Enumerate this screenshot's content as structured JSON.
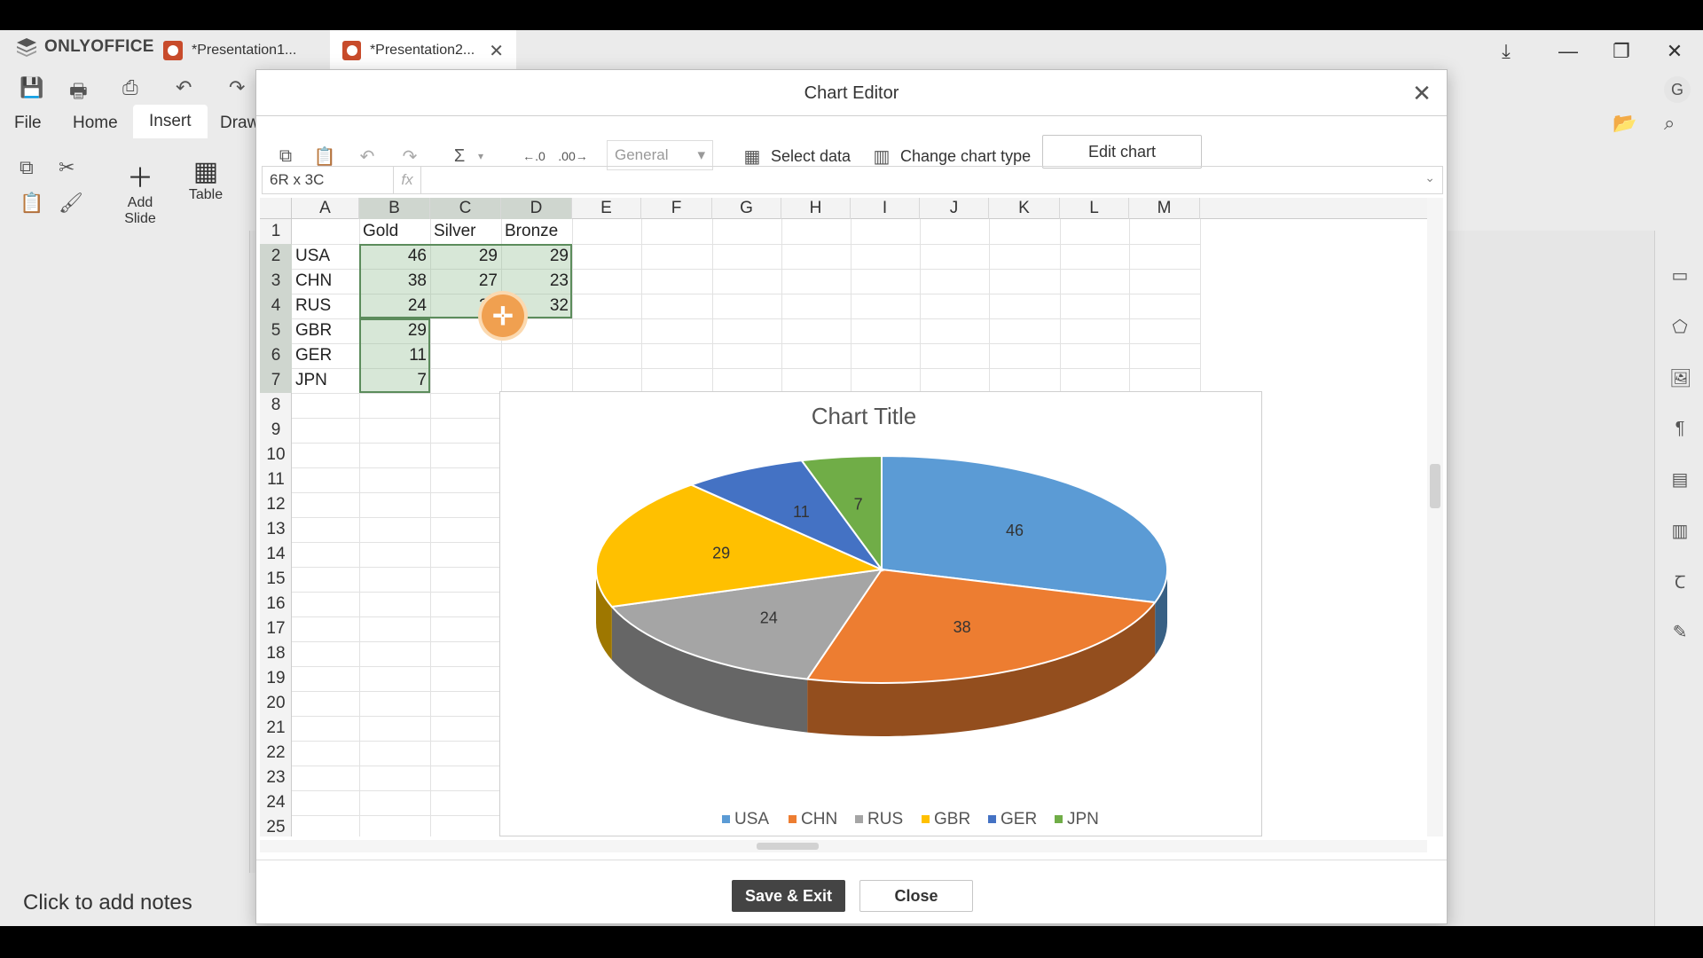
{
  "app": {
    "brand": "ONLYOFFICE",
    "tabs": [
      {
        "label": "*Presentation1...",
        "active": false
      },
      {
        "label": "*Presentation2...",
        "active": true
      }
    ],
    "user_initial": "G"
  },
  "ribbon": {
    "menu": [
      "File",
      "Home",
      "Insert",
      "Draw"
    ],
    "active_menu": "Insert",
    "add_slide": "Add Slide",
    "table": "Table"
  },
  "notes_placeholder": "Click to add notes",
  "dialog": {
    "title": "Chart Editor",
    "select_data": "Select data",
    "change_chart_type": "Change chart type",
    "edit_chart": "Edit chart",
    "number_format": "General",
    "cell_ref": "6R x 3C",
    "fx": "fx",
    "save_exit": "Save & Exit",
    "close": "Close"
  },
  "sheet": {
    "columns": [
      "A",
      "B",
      "C",
      "D",
      "E",
      "F",
      "G",
      "H",
      "I",
      "J",
      "K",
      "L",
      "M"
    ],
    "rows": [
      "1",
      "2",
      "3",
      "4",
      "5",
      "6",
      "7",
      "8",
      "9",
      "10",
      "11",
      "12",
      "13",
      "14",
      "15",
      "16",
      "17",
      "18",
      "19",
      "20",
      "21",
      "22",
      "23",
      "24",
      "25"
    ],
    "header": [
      "",
      "Gold",
      "Silver",
      "Bronze"
    ],
    "data": [
      [
        "USA",
        "46",
        "29",
        "29"
      ],
      [
        "CHN",
        "38",
        "27",
        "23"
      ],
      [
        "RUS",
        "24",
        "26",
        "32"
      ],
      [
        "GBR",
        "29",
        "",
        ""
      ],
      [
        "GER",
        "11",
        "",
        ""
      ],
      [
        "JPN",
        "7",
        "",
        ""
      ]
    ]
  },
  "chart_data": {
    "type": "pie",
    "title": "Chart Title",
    "categories": [
      "USA",
      "CHN",
      "RUS",
      "GBR",
      "GER",
      "JPN"
    ],
    "values": [
      46,
      38,
      24,
      29,
      11,
      7
    ],
    "colors": [
      "#5b9bd5",
      "#ed7d31",
      "#a5a5a5",
      "#ffc000",
      "#4472c4",
      "#70ad47"
    ],
    "legend": "bottom",
    "style": "3d"
  }
}
